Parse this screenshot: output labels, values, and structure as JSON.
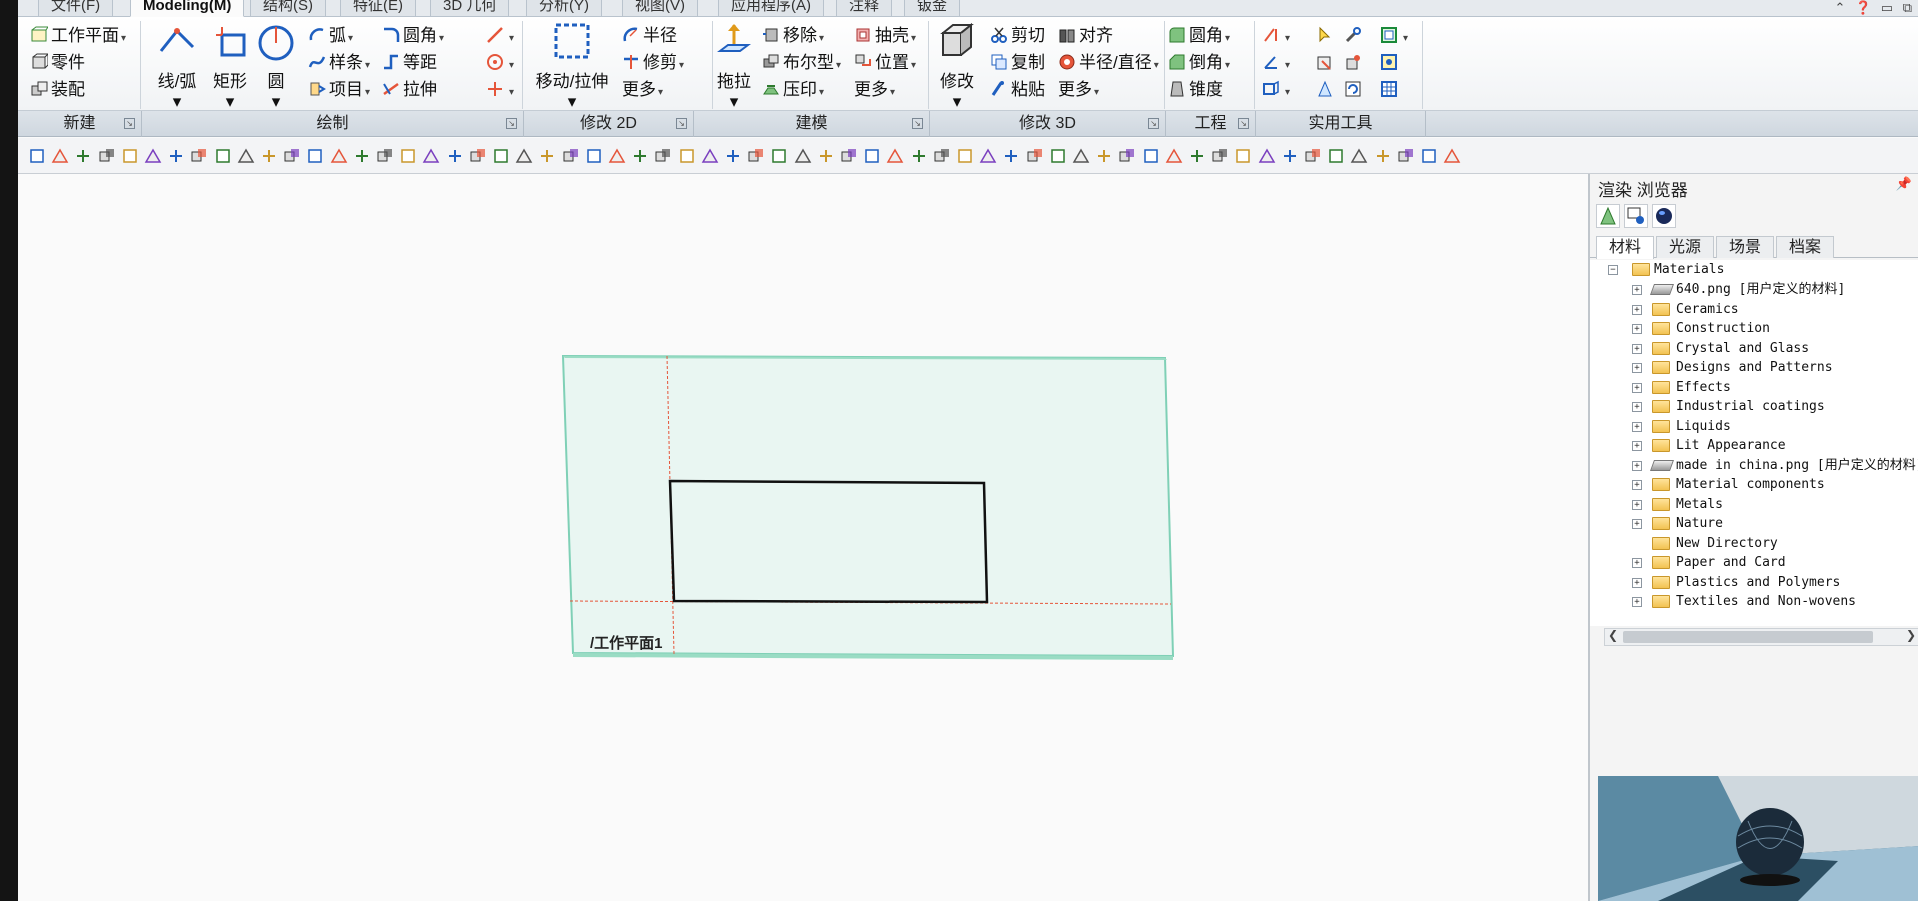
{
  "tabs": [
    {
      "label": "文件(F)",
      "active": false
    },
    {
      "label": "Modeling(M)",
      "active": true
    },
    {
      "label": "结构(S)",
      "active": false
    },
    {
      "label": "特征(E)",
      "active": false
    },
    {
      "label": "3D 几何",
      "active": false
    },
    {
      "label": "分析(Y)",
      "active": false
    },
    {
      "label": "视图(V)",
      "active": false
    },
    {
      "label": "应用程序(A)",
      "active": false
    },
    {
      "label": "注释",
      "active": false
    },
    {
      "label": "钣金",
      "active": false
    }
  ],
  "ribbon": {
    "new": {
      "workplane": "工作平面",
      "part": "零件",
      "assembly": "装配"
    },
    "draw": {
      "line_arc": "线/弧",
      "rectangle": "矩形",
      "circle": "圆",
      "arc": "弧",
      "spline": "样条",
      "project": "项目",
      "fillet": "圆角",
      "offset": "等距",
      "extrude": "拉伸"
    },
    "modify2d": {
      "move_stretch": "移动/拉伸",
      "radius": "半径",
      "trim": "修剪",
      "more": "更多"
    },
    "modeling": {
      "pull": "拖拉",
      "move": "移除",
      "boolean": "布尔型",
      "emboss": "压印",
      "shell": "抽壳",
      "position": "位置",
      "more": "更多"
    },
    "modify3d": {
      "modify": "修改",
      "cut": "剪切",
      "copy": "复制",
      "paste": "粘贴",
      "align": "对齐",
      "radius_diameter": "半径/直径",
      "more": "更多"
    },
    "engineering": {
      "fillet": "圆角",
      "chamfer": "倒角",
      "taper": "锥度"
    }
  },
  "group_labels": {
    "new": "新建",
    "draw": "绘制",
    "modify2d": "修改 2D",
    "modeling": "建模",
    "modify3d": "修改 3D",
    "engineering": "工程",
    "utilities": "实用工具"
  },
  "viewport": {
    "workplane_label": "/工作平面1"
  },
  "panel": {
    "title": "渲染 浏览器",
    "tabs": [
      "材料",
      "光源",
      "场景",
      "档案"
    ],
    "root": "Materials",
    "items": [
      {
        "label": "640.png [用户定义的材料]",
        "kind": "material",
        "expandable": true
      },
      {
        "label": "Ceramics",
        "kind": "folder",
        "expandable": true
      },
      {
        "label": "Construction",
        "kind": "folder",
        "expandable": true
      },
      {
        "label": "Crystal and Glass",
        "kind": "folder",
        "expandable": true
      },
      {
        "label": "Designs and Patterns",
        "kind": "folder",
        "expandable": true
      },
      {
        "label": "Effects",
        "kind": "folder",
        "expandable": true
      },
      {
        "label": "Industrial coatings",
        "kind": "folder",
        "expandable": true
      },
      {
        "label": "Liquids",
        "kind": "folder",
        "expandable": true
      },
      {
        "label": "Lit Appearance",
        "kind": "folder",
        "expandable": true
      },
      {
        "label": "made in china.png [用户定义的材料]",
        "kind": "material",
        "expandable": true
      },
      {
        "label": "Material components",
        "kind": "folder",
        "expandable": true
      },
      {
        "label": "Metals",
        "kind": "folder",
        "expandable": true
      },
      {
        "label": "Nature",
        "kind": "folder",
        "expandable": true
      },
      {
        "label": "New Directory",
        "kind": "folder",
        "expandable": false
      },
      {
        "label": "Paper and Card",
        "kind": "folder",
        "expandable": true
      },
      {
        "label": "Plastics and Polymers",
        "kind": "folder",
        "expandable": true
      },
      {
        "label": "Textiles and Non-wovens",
        "kind": "folder",
        "expandable": true
      }
    ]
  },
  "colors": {
    "accent_blue": "#1f5fbf",
    "workplane_fill": "#e9f6f2",
    "workplane_edge": "#7fd0b6",
    "axis_red": "#e5553a"
  }
}
